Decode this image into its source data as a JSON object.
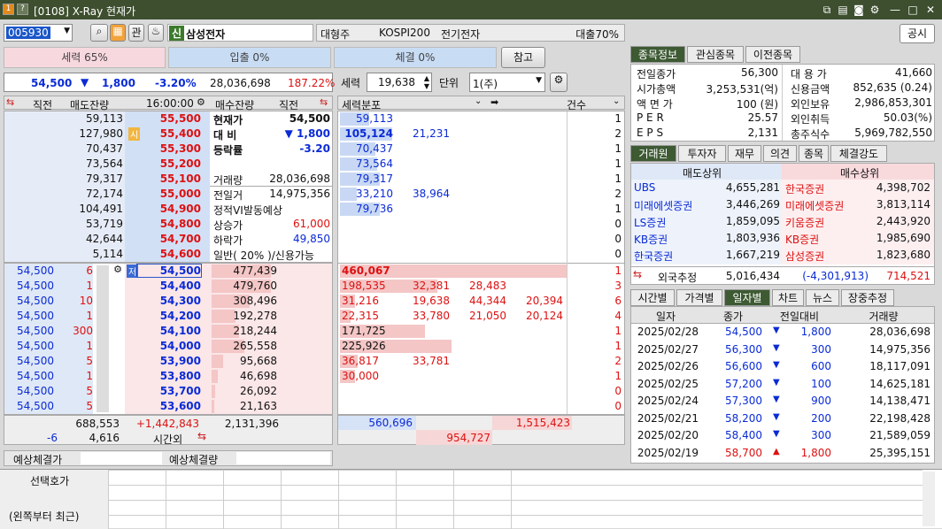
{
  "window": {
    "title": "[0108] X-Ray 현재가",
    "help": "?",
    "num": "1"
  },
  "top": {
    "code": "005930",
    "name": "삼성전자",
    "badge": "신",
    "kwan": "관",
    "market_info": "대형주",
    "index": "KOSPI200",
    "sector": "전기전자",
    "loan": "대출70%",
    "public_btn": "공시",
    "ref_btn": "참고"
  },
  "strength": {
    "power": "세력 65%",
    "inout": "입출 0%",
    "exec": "체결 0%"
  },
  "price_row": {
    "price": "54,500",
    "arrow": "▼",
    "change": "1,800",
    "rate": "-3.20%",
    "volume": "28,036,698",
    "pct": "187.22%"
  },
  "power_filter": {
    "label": "세력",
    "value": "19,638",
    "unit_label": "단위",
    "unit": "1(주)"
  },
  "ob_head": {
    "prev": "직전",
    "ask_rem": "매도잔량",
    "time": "16:00:00",
    "bid_rem": "매수잔량",
    "prev2": "직전",
    "dist": "세력분포",
    "cnt": "건수"
  },
  "asks": [
    {
      "qty": "59,113",
      "price": "55,500",
      "dist": [
        "59,113"
      ],
      "cnt": "1"
    },
    {
      "qty": "127,980",
      "price": "55,400",
      "dist": [
        "105,124",
        "21,231"
      ],
      "cnt": "2",
      "mark": "시"
    },
    {
      "qty": "70,437",
      "price": "55,300",
      "dist": [
        "70,437"
      ],
      "cnt": "1"
    },
    {
      "qty": "73,564",
      "price": "55,200",
      "dist": [
        "73,564"
      ],
      "cnt": "1"
    },
    {
      "qty": "79,317",
      "price": "55,100",
      "dist": [
        "79,317"
      ],
      "cnt": "1"
    },
    {
      "qty": "72,174",
      "price": "55,000",
      "dist": [
        "33,210",
        "38,964"
      ],
      "cnt": "2"
    },
    {
      "qty": "104,491",
      "price": "54,900",
      "dist": [
        "79,736"
      ],
      "cnt": "1"
    },
    {
      "qty": "53,719",
      "price": "54,800",
      "dist": [],
      "cnt": "0"
    },
    {
      "qty": "42,644",
      "price": "54,700",
      "dist": [],
      "cnt": "0"
    },
    {
      "qty": "5,114",
      "price": "54,600",
      "dist": [],
      "cnt": "0"
    }
  ],
  "info": [
    {
      "k": "현재가",
      "v": "54,500"
    },
    {
      "k": "대 비",
      "v": "▼ 1,800"
    },
    {
      "k": "등락률",
      "v": "-3.20"
    },
    {
      "k": "",
      "v": ""
    },
    {
      "k": "거래량",
      "v": "28,036,698"
    },
    {
      "k": "전일거",
      "v": "14,975,356"
    },
    {
      "k": "정적VI발동예상",
      "v": ""
    },
    {
      "k": "상승가",
      "v": "61,000"
    },
    {
      "k": "하락가",
      "v": "49,850"
    },
    {
      "k": "일반( 20% )/신용가능",
      "v": ""
    }
  ],
  "bids": [
    {
      "prev": "54,500",
      "n": "6",
      "price": "54,500",
      "qty": "477,439",
      "dist": [
        "460,067"
      ],
      "cnt": "1",
      "mark": "저"
    },
    {
      "prev": "54,500",
      "n": "1",
      "price": "54,400",
      "qty": "479,760",
      "dist": [
        "198,535",
        "32,381",
        "28,483"
      ],
      "cnt": "3"
    },
    {
      "prev": "54,500",
      "n": "10",
      "price": "54,300",
      "qty": "308,496",
      "dist": [
        "31,216",
        "19,638",
        "44,344",
        "20,394"
      ],
      "cnt": "6"
    },
    {
      "prev": "54,500",
      "n": "1",
      "price": "54,200",
      "qty": "192,278",
      "dist": [
        "22,315",
        "33,780",
        "21,050",
        "20,124"
      ],
      "cnt": "4"
    },
    {
      "prev": "54,500",
      "n": "300",
      "price": "54,100",
      "qty": "218,244",
      "dist": [
        "171,725"
      ],
      "cnt": "1"
    },
    {
      "prev": "54,500",
      "n": "1",
      "price": "54,000",
      "qty": "265,558",
      "dist": [
        "225,926"
      ],
      "cnt": "1"
    },
    {
      "prev": "54,500",
      "n": "5",
      "price": "53,900",
      "qty": "95,668",
      "dist": [
        "36,817",
        "33,781"
      ],
      "cnt": "2"
    },
    {
      "prev": "54,500",
      "n": "1",
      "price": "53,800",
      "qty": "46,698",
      "dist": [
        "30,000"
      ],
      "cnt": "1"
    },
    {
      "prev": "54,500",
      "n": "5",
      "price": "53,700",
      "qty": "26,092",
      "dist": [],
      "cnt": "0"
    },
    {
      "prev": "54,500",
      "n": "5",
      "price": "53,600",
      "qty": "21,163",
      "dist": [],
      "cnt": "0"
    }
  ],
  "totals": {
    "ask_total": "688,553",
    "diff": "+1,442,843",
    "bid_total": "2,131,396",
    "minus": "-6",
    "after": "4,616",
    "after_label": "시간외",
    "dist_ask": "560,696",
    "dist_bid": "1,515,423",
    "dist_diff": "954,727"
  },
  "expected": {
    "price_label": "예상체결가",
    "qty_label": "예상체결량"
  },
  "bottom": {
    "label1": "선택호가",
    "label2": "(왼쪽부터 최근)"
  },
  "stock_tabs": [
    "종목정보",
    "관심종목",
    "이전종목"
  ],
  "stock_info": [
    {
      "k": "전일종가",
      "v": "56,300",
      "k2": "대 용 가",
      "v2": "41,660"
    },
    {
      "k": "시가총액",
      "v": "3,253,531(억)",
      "k2": "신용금액",
      "v2": "852,635  (0.24)"
    },
    {
      "k": "액 면 가",
      "v": "100 (원)",
      "k2": "외인보유",
      "v2": "2,986,853,301"
    },
    {
      "k": "P E R",
      "v": "25.57",
      "k2": "외인취득",
      "v2": "50.03(%)"
    },
    {
      "k": "E P S",
      "v": "2,131",
      "k2": "총주식수",
      "v2": "5,969,782,550"
    }
  ],
  "broker_tabs": [
    "거래원",
    "투자자",
    "재무",
    "의견",
    "종목",
    "체결강도"
  ],
  "broker": {
    "sell_head": "매도상위",
    "buy_head": "매수상위",
    "foreign_label": "외국추정",
    "foreign_sell": "5,016,434",
    "foreign_net": "(-4,301,913)",
    "foreign_buy": "714,521",
    "rows": [
      {
        "s": "UBS",
        "sv": "4,655,281",
        "b": "한국증권",
        "bv": "4,398,702"
      },
      {
        "s": "미래에셋증권",
        "sv": "3,446,269",
        "b": "미래에셋증권",
        "bv": "3,813,114"
      },
      {
        "s": "LS증권",
        "sv": "1,859,095",
        "b": "키움증권",
        "bv": "2,443,920"
      },
      {
        "s": "KB증권",
        "sv": "1,803,936",
        "b": "KB증권",
        "bv": "1,985,690"
      },
      {
        "s": "한국증권",
        "sv": "1,667,219",
        "b": "삼성증권",
        "bv": "1,823,680"
      }
    ]
  },
  "daily_tabs": [
    "시간별",
    "가격별",
    "일자별",
    "차트",
    "뉴스",
    "장중추정"
  ],
  "daily": {
    "headers": [
      "일자",
      "종가",
      "전일대비",
      "거래량"
    ],
    "rows": [
      {
        "d": "2025/02/28",
        "c": "54,500",
        "dir": "▼",
        "chg": "1,800",
        "vol": "28,036,698"
      },
      {
        "d": "2025/02/27",
        "c": "56,300",
        "dir": "▼",
        "chg": "300",
        "vol": "14,975,356"
      },
      {
        "d": "2025/02/26",
        "c": "56,600",
        "dir": "▼",
        "chg": "600",
        "vol": "18,117,091"
      },
      {
        "d": "2025/02/25",
        "c": "57,200",
        "dir": "▼",
        "chg": "100",
        "vol": "14,625,181"
      },
      {
        "d": "2025/02/24",
        "c": "57,300",
        "dir": "▼",
        "chg": "900",
        "vol": "14,138,471"
      },
      {
        "d": "2025/02/21",
        "c": "58,200",
        "dir": "▼",
        "chg": "200",
        "vol": "22,198,428"
      },
      {
        "d": "2025/02/20",
        "c": "58,400",
        "dir": "▼",
        "chg": "300",
        "vol": "21,589,059"
      },
      {
        "d": "2025/02/19",
        "c": "58,700",
        "dir": "▲",
        "chg": "1,800",
        "vol": "25,395,151"
      }
    ]
  }
}
